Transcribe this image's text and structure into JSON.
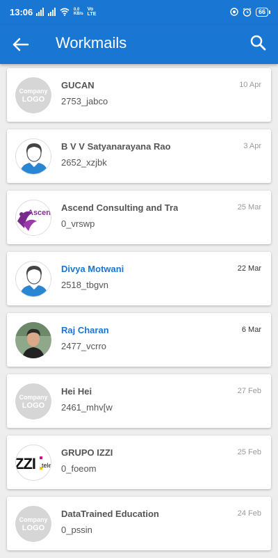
{
  "status": {
    "time": "13:06",
    "speed_top": "0.0",
    "speed_bottom": "KB/s",
    "vo": "Vo",
    "lte": "LTE",
    "battery": "66"
  },
  "appbar": {
    "title": "Workmails",
    "back_icon": "arrow-left-icon",
    "search_icon": "search-icon"
  },
  "colors": {
    "primary": "#1976d2",
    "unread_text": "#1976d2",
    "placeholder_logo": "#d6d6d6"
  },
  "placeholder_logo": {
    "line1": "Company",
    "line2": "LOGO"
  },
  "avatar_texts": {
    "ascend": "Ascen",
    "izzi": "ZZI",
    "tele": "tele"
  },
  "items": [
    {
      "name": "GUCAN",
      "code": "2753_jabco",
      "date": "10 Apr",
      "unread": false,
      "avatar": "company-logo-placeholder"
    },
    {
      "name": "B V V Satyanarayana Rao",
      "code": "2652_xzjbk",
      "date": "3 Apr",
      "unread": false,
      "avatar": "person-silhouette"
    },
    {
      "name": "Ascend Consulting and Tra",
      "code": "0_vrswp",
      "date": "25 Mar",
      "unread": false,
      "avatar": "ascend-logo"
    },
    {
      "name": "Divya Motwani",
      "code": "2518_tbgvn",
      "date": "22 Mar",
      "unread": true,
      "avatar": "person-silhouette"
    },
    {
      "name": "Raj Charan",
      "code": "2477_vcrro",
      "date": "6 Mar",
      "unread": true,
      "avatar": "person-photo"
    },
    {
      "name": "Hei Hei",
      "code": "2461_mhv[w",
      "date": "27 Feb",
      "unread": false,
      "avatar": "company-logo-placeholder"
    },
    {
      "name": "GRUPO IZZI",
      "code": "0_foeom",
      "date": "25 Feb",
      "unread": false,
      "avatar": "izzi-logo"
    },
    {
      "name": "DataTrained Education",
      "code": "0_pssin",
      "date": "24 Feb",
      "unread": false,
      "avatar": "company-logo-placeholder"
    }
  ]
}
